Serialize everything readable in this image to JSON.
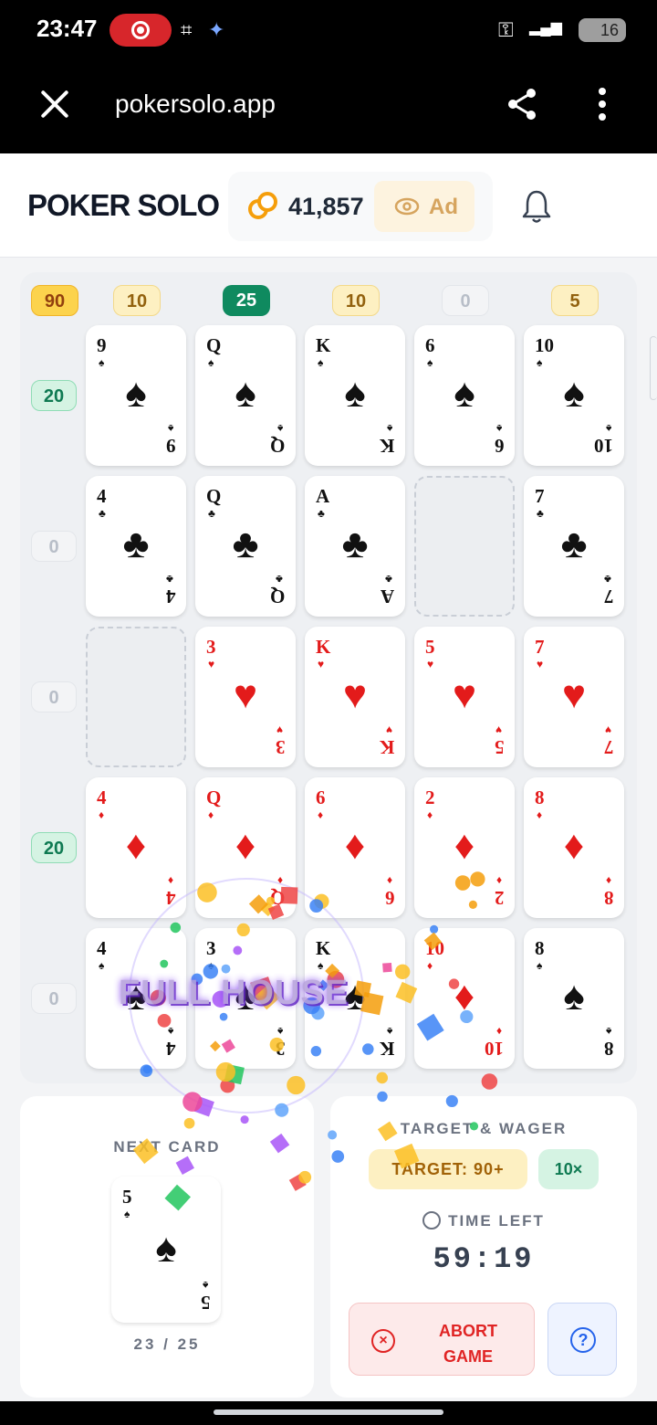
{
  "status_bar": {
    "time": "23:47",
    "battery": "16"
  },
  "browser": {
    "url": "pokersolo.app"
  },
  "header": {
    "logo": "POKER SOLO",
    "coins": "41,857",
    "ad_label": "Ad"
  },
  "board": {
    "col_scores": [
      "90",
      "10",
      "25",
      "10",
      "0",
      "5"
    ],
    "row_scores": [
      "20",
      "0",
      "0",
      "20",
      "0"
    ],
    "rows": [
      [
        {
          "rank": "9",
          "suit": "♠",
          "color": "black"
        },
        {
          "rank": "Q",
          "suit": "♠",
          "color": "black"
        },
        {
          "rank": "K",
          "suit": "♠",
          "color": "black"
        },
        {
          "rank": "6",
          "suit": "♠",
          "color": "black"
        },
        {
          "rank": "10",
          "suit": "♠",
          "color": "black"
        }
      ],
      [
        {
          "rank": "4",
          "suit": "♣",
          "color": "black"
        },
        {
          "rank": "Q",
          "suit": "♣",
          "color": "black"
        },
        {
          "rank": "A",
          "suit": "♣",
          "color": "black"
        },
        null,
        {
          "rank": "7",
          "suit": "♣",
          "color": "black"
        }
      ],
      [
        null,
        {
          "rank": "3",
          "suit": "♥",
          "color": "red"
        },
        {
          "rank": "K",
          "suit": "♥",
          "color": "red"
        },
        {
          "rank": "5",
          "suit": "♥",
          "color": "red"
        },
        {
          "rank": "7",
          "suit": "♥",
          "color": "red"
        }
      ],
      [
        {
          "rank": "4",
          "suit": "♦",
          "color": "red"
        },
        {
          "rank": "Q",
          "suit": "♦",
          "color": "red"
        },
        {
          "rank": "6",
          "suit": "♦",
          "color": "red"
        },
        {
          "rank": "2",
          "suit": "♦",
          "color": "red"
        },
        {
          "rank": "8",
          "suit": "♦",
          "color": "red"
        }
      ],
      [
        {
          "rank": "4",
          "suit": "♠",
          "color": "black"
        },
        {
          "rank": "3",
          "suit": "♠",
          "color": "black"
        },
        {
          "rank": "K",
          "suit": "♠",
          "color": "black"
        },
        {
          "rank": "10",
          "suit": "♦",
          "color": "red"
        },
        {
          "rank": "8",
          "suit": "♠",
          "color": "black"
        }
      ]
    ]
  },
  "celebration": {
    "text": "FULL HOUSE"
  },
  "next_card": {
    "label": "NEXT CARD",
    "rank": "5",
    "suit": "♠",
    "color": "black",
    "count": "23 / 25"
  },
  "target": {
    "label": "TARGET & WAGER",
    "target_text": "TARGET: 90+",
    "wager": "10×",
    "time_label": "TIME LEFT",
    "time_value": "59:19",
    "abort_label": "ABORT GAME",
    "help_label": "?"
  }
}
